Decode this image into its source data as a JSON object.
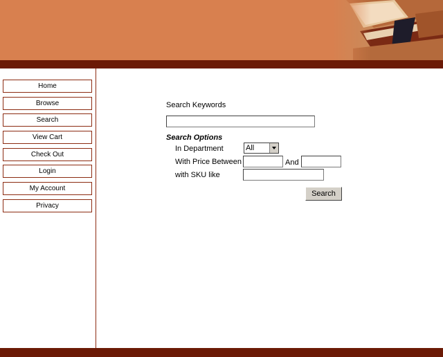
{
  "nav": {
    "items": [
      {
        "label": "Home"
      },
      {
        "label": "Browse"
      },
      {
        "label": "Search"
      },
      {
        "label": "View Cart"
      },
      {
        "label": "Check Out"
      },
      {
        "label": "Login"
      },
      {
        "label": "My Account"
      },
      {
        "label": "Privacy"
      }
    ]
  },
  "search": {
    "keywords_label": "Search Keywords",
    "keywords_value": "",
    "options_title": "Search Options",
    "department_label": "In Department",
    "department_value": "All",
    "price_label": "With Price Between",
    "price_and": "And",
    "price_min": "",
    "price_max": "",
    "sku_label": "with SKU like",
    "sku_value": "",
    "button_label": "Search"
  },
  "colors": {
    "header": "#d8804f",
    "band": "#6b1a06",
    "border": "#8b2a10"
  }
}
